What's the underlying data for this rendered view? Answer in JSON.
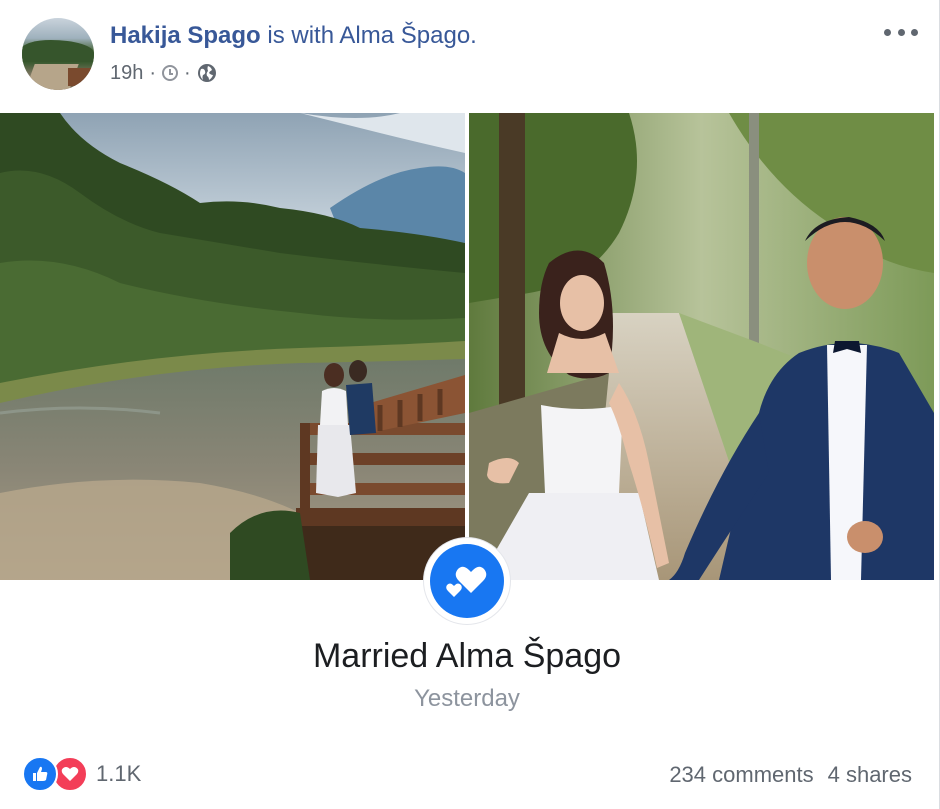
{
  "post": {
    "author": "Hakija Spago",
    "with_text": " is with ",
    "tagged_person": "Alma Špago",
    "title_end": ".",
    "time": "19h",
    "time_separator": "·",
    "privacy_separator": "·",
    "icons": {
      "avatar": "profile-photo",
      "clock": "clock-icon",
      "globe": "globe-icon",
      "more": "more-options-icon"
    }
  },
  "photos": [
    {
      "name": "photo-couple-on-balcony-by-river"
    },
    {
      "name": "photo-couple-holding-hands"
    }
  ],
  "life_event": {
    "icon": "hearts-icon",
    "title": "Married Alma Špago",
    "date": "Yesterday",
    "accent_color": "#1877f2"
  },
  "footer": {
    "reactions": [
      "like",
      "love"
    ],
    "reaction_count": "1.1K",
    "comments": "234 comments",
    "shares": "4 shares",
    "colors": {
      "like": "#1877f2",
      "love": "#f33e58"
    }
  }
}
